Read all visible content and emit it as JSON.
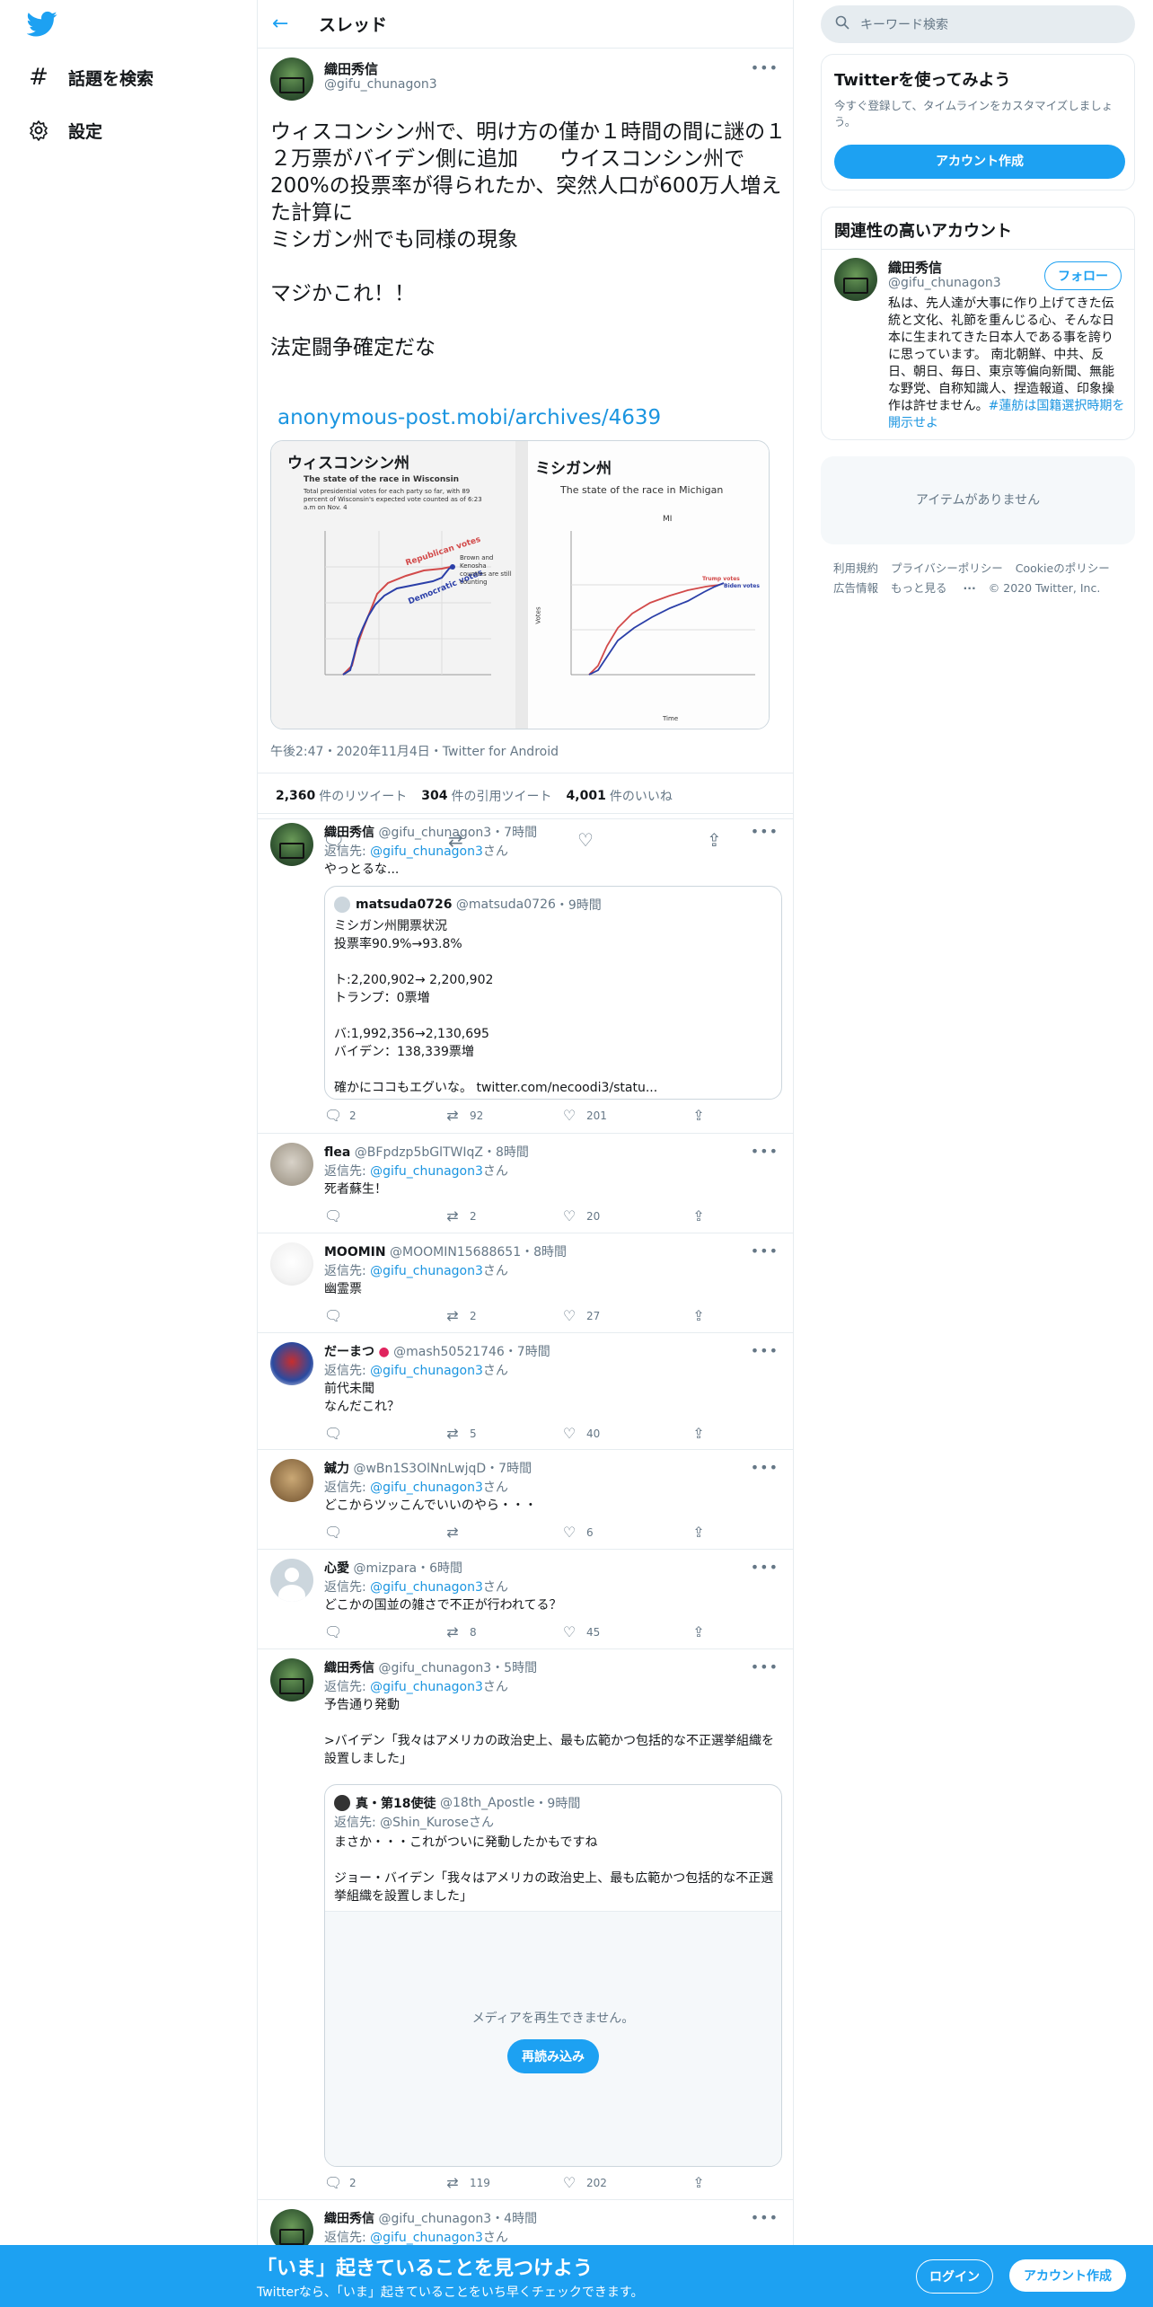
{
  "nav": {
    "explore_label": "話題を検索",
    "settings_label": "設定"
  },
  "header": {
    "title": "スレッド"
  },
  "main_tweet": {
    "name": "織田秀信",
    "handle": "@gifu_chunagon3",
    "text": "ウィスコンシン州で、明け方の僅か１時間の間に謎の１２万票がバイデン側に追加　　ウイスコンシン州で200%の投票率が得られたか、突然人口が600万人増えた計算に\nミシガン州でも同様の現象\n\nマジかこれ！！\n\n法定闘争確定だな",
    "link": "anonymous-post.mobi/archives/4639",
    "media": {
      "left_title": "ウィスコンシン州",
      "left_chart_title": "The state of the race in Wisconsin",
      "left_chart_sub": "Total presidential votes for each party so far, with 89 percent of Wisconsin's expected vote counted as of 6:23 a.m on Nov. 4",
      "left_note": "Brown and Kenosha counties are still counting",
      "left_rep": "Republican votes",
      "left_dem": "Democratic votes",
      "right_title": "ミシガン州",
      "right_chart_title": "The state of the race in Michigan",
      "right_state": "MI",
      "right_trump": "Trump votes",
      "right_biden": "Biden votes",
      "right_x": "Time",
      "right_y": "Votes"
    },
    "timestamp": "午後2:47・2020年11月4日・Twitter for Android",
    "retweets_count": "2,360",
    "retweets_label": "件のリツイート",
    "quotes_count": "304",
    "quotes_label": "件の引用ツイート",
    "likes_count": "4,001",
    "likes_label": "件のいいね"
  },
  "replies": [
    {
      "name": "織田秀信",
      "handle": "@gifu_chunagon3",
      "time": "・7時間",
      "to_prefix": "返信先: ",
      "to": "@gifu_chunagon3",
      "to_suffix": "さん",
      "text": "やっとるな...",
      "quote": {
        "name": "matsuda0726",
        "handle": "@matsuda0726",
        "time": "・9時間",
        "text": "ミシガン州開票状況\n投票率90.9%→93.8%\n\nト:2,200,902→ 2,200,902\nトランプ：0票増\n\nバ:1,992,356→2,130,695\nバイデン：138,339票増\n\n確かにココもエグいな。 twitter.com/necoodi3/statu..."
      },
      "reply_count": "2",
      "rt_count": "92",
      "like_count": "201"
    },
    {
      "name": "flea",
      "handle": "@BFpdzp5bGlTWIqZ",
      "time": "・8時間",
      "to_prefix": "返信先: ",
      "to": "@gifu_chunagon3",
      "to_suffix": "さん",
      "text": "死者蘇生！",
      "reply_count": "",
      "rt_count": "2",
      "like_count": "20"
    },
    {
      "name": "MOOMIN",
      "handle": "@MOOMIN15688651",
      "time": "・8時間",
      "to_prefix": "返信先: ",
      "to": "@gifu_chunagon3",
      "to_suffix": "さん",
      "text": "幽霊票",
      "reply_count": "",
      "rt_count": "2",
      "like_count": "27"
    },
    {
      "name": "だーまつ",
      "handle": "@mash50521746",
      "time": "・7時間",
      "to_prefix": "返信先: ",
      "to": "@gifu_chunagon3",
      "to_suffix": "さん",
      "text": "前代未聞\nなんだこれ？",
      "reply_count": "",
      "rt_count": "5",
      "like_count": "40"
    },
    {
      "name": "鍼力",
      "handle": "@wBn1S3OlNnLwjqD",
      "time": "・7時間",
      "to_prefix": "返信先: ",
      "to": "@gifu_chunagon3",
      "to_suffix": "さん",
      "text": "どこからツッこんでいいのやら・・・",
      "reply_count": "",
      "rt_count": "",
      "like_count": "6"
    },
    {
      "name": "心愛",
      "handle": "@mizpara",
      "time": "・6時間",
      "to_prefix": "返信先: ",
      "to": "@gifu_chunagon3",
      "to_suffix": "さん",
      "text": "どこかの国並の雑さで不正が行われてる？",
      "reply_count": "",
      "rt_count": "8",
      "like_count": "45"
    },
    {
      "name": "織田秀信",
      "handle": "@gifu_chunagon3",
      "time": "・5時間",
      "to_prefix": "返信先: ",
      "to": "@gifu_chunagon3",
      "to_suffix": "さん",
      "text": "予告通り発動\n\n>バイデン「我々はアメリカの政治史上、最も広範かつ包括的な不正選挙組織を設置しました」",
      "quote": {
        "name": "真・第18使徒",
        "handle": "@18th_Apostle",
        "time": "・9時間",
        "to_prefix": "返信先: ",
        "to": "@Shin_Kurose",
        "to_suffix": "さん",
        "text": "まさか・・・これがついに発動したかもですね\n\nジョー・バイデン「我々はアメリカの政治史上、最も広範かつ包括的な不正選挙組織を設置しました」",
        "media_msg": "メディアを再生できません。",
        "reload": "再読み込み"
      },
      "reply_count": "2",
      "rt_count": "119",
      "like_count": "202"
    },
    {
      "name": "織田秀信",
      "handle": "@gifu_chunagon3",
      "time": "・4時間",
      "to_prefix": "返信先: ",
      "to": "@gifu_chunagon3",
      "to_suffix": "さん"
    }
  ],
  "right": {
    "search_placeholder": "キーワード検索",
    "signup_title": "Twitterを使ってみよう",
    "signup_desc": "今すぐ登録して、タイムラインをカスタマイズしましょう。",
    "signup_button": "アカウント作成",
    "related_title": "関連性の高いアカウント",
    "related_name": "織田秀信",
    "related_handle": "@gifu_chunagon3",
    "follow_button": "フォロー",
    "related_bio": "私は、先人達が大事に作り上げてきた伝統と文化、礼節を重んじる心、そんな日本に生まれてきた日本人である事を誇りに思っています。 南北朝鮮、中共、反日、朝日、毎日、東京等偏向新聞、無能な野党、自称知識人、捏造報道、印象操作は許せません。",
    "related_bio_link": "#蓮舫は国籍選択時期を開示せよ",
    "trends_empty": "アイテムがありません",
    "footer": [
      "利用規約",
      "プライバシーポリシー",
      "Cookieのポリシー",
      "広告情報",
      "もっと見る",
      "© 2020 Twitter, Inc."
    ]
  },
  "banner": {
    "headline": "「いま」起きていることを見つけよう",
    "sub": "Twitterなら、「いま」起きていることをいち早くチェックできます。",
    "login": "ログイン",
    "signup": "アカウント作成"
  },
  "colors": {
    "accent": "#1da1f2",
    "link": "#1b95e0",
    "banner": "#1da1f2"
  }
}
